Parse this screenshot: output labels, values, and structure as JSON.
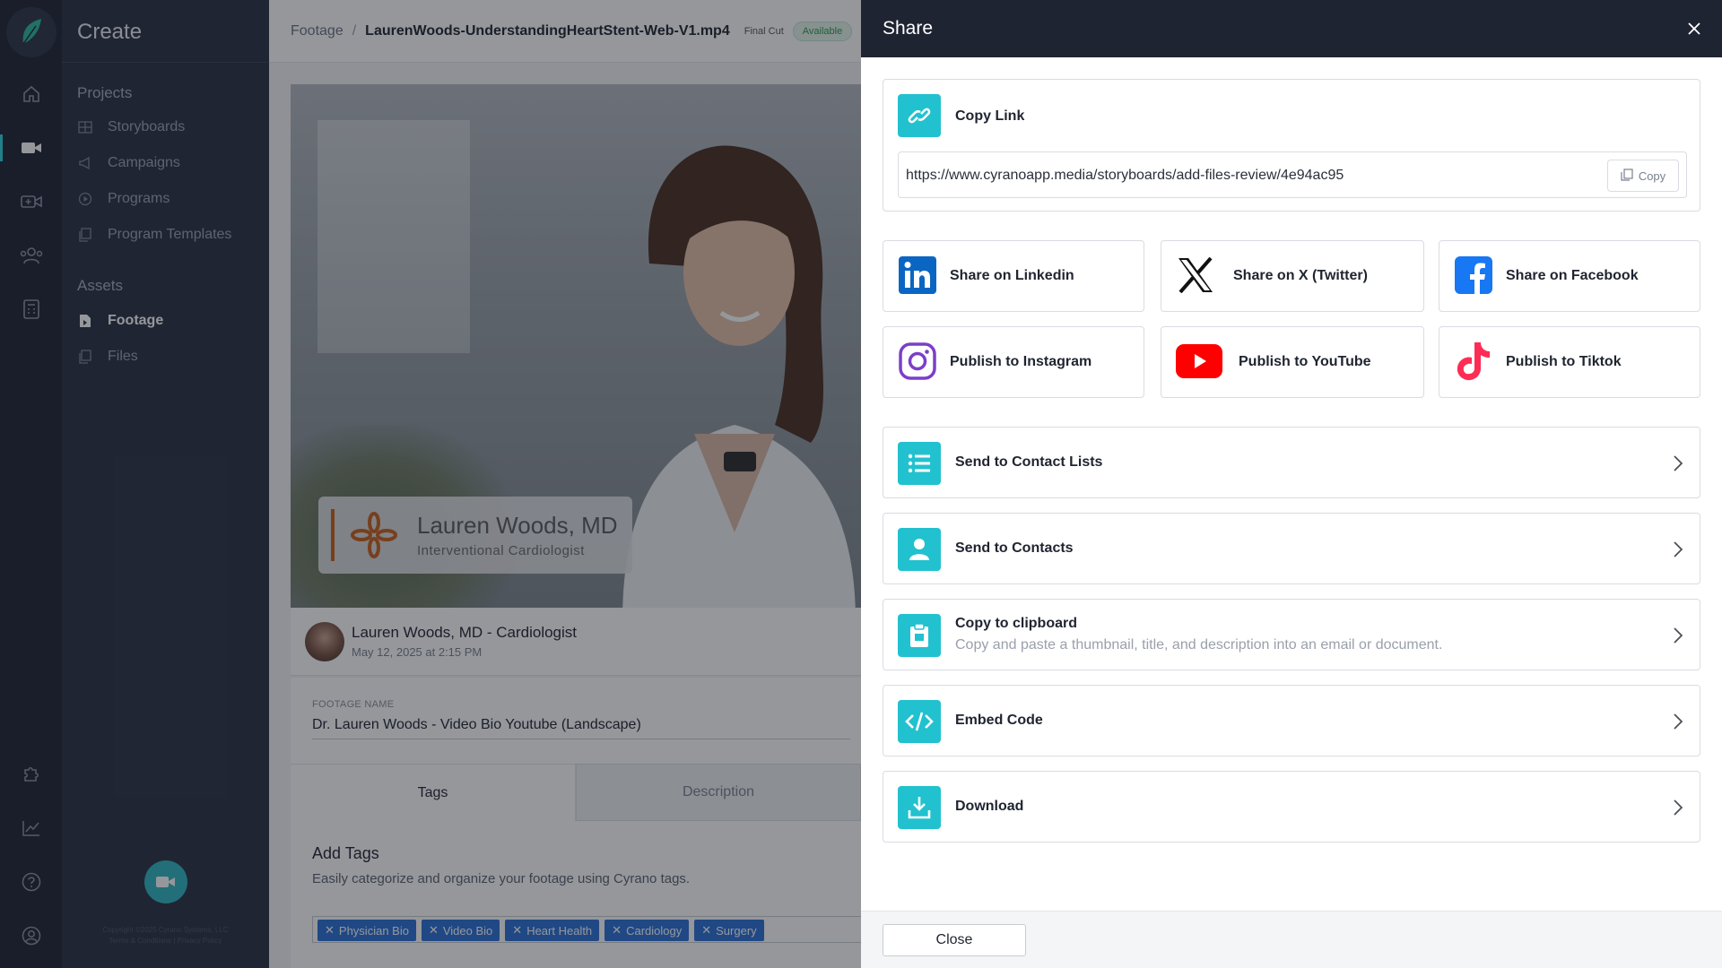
{
  "app": {
    "title": "Create",
    "copyright_line1": "Copyright ©2025 Cyrano Systems, LLC",
    "copyright_line2": "Terms & Conditions | Privacy Policy"
  },
  "rail": {
    "icons": [
      "leaf-logo-icon",
      "home-icon",
      "video-camera-icon",
      "video-add-icon",
      "users-icon",
      "calculator-icon",
      "puzzle-icon",
      "chart-icon",
      "help-icon",
      "user-circle-icon"
    ]
  },
  "nav": {
    "projects_label": "Projects",
    "projects": [
      {
        "label": "Storyboards",
        "icon": "grid-icon"
      },
      {
        "label": "Campaigns",
        "icon": "megaphone-icon"
      },
      {
        "label": "Programs",
        "icon": "play-circle-icon"
      },
      {
        "label": "Program Templates",
        "icon": "copy-icon"
      }
    ],
    "assets_label": "Assets",
    "assets": [
      {
        "label": "Footage",
        "icon": "film-icon",
        "active": true
      },
      {
        "label": "Files",
        "icon": "files-icon"
      }
    ]
  },
  "main": {
    "breadcrumb_root": "Footage",
    "breadcrumb_sep": "/",
    "file_name": "LaurenWoods-UnderstandingHeartStent-Web-V1.mp4",
    "stage_tag": "Final Cut",
    "status_badge": "Available",
    "lower_third_name": "Lauren Woods, MD",
    "lower_third_role": "Interventional Cardiologist",
    "uploader": "Lauren Woods,  MD - Cardiologist",
    "uploaded_at": "May 12, 2025 at 2:15 PM",
    "footage_name_label": "FOOTAGE NAME",
    "footage_name_value": "Dr. Lauren Woods  - Video Bio Youtube (Landscape)",
    "tabs": [
      "Tags",
      "Description"
    ],
    "tags_heading": "Add Tags",
    "tags_help": "Easily categorize and organize your footage using Cyrano tags.",
    "tags": [
      "Physician Bio",
      "Video Bio",
      "Heart Health",
      "Cardiology",
      "Surgery"
    ]
  },
  "share": {
    "title": "Share",
    "copy_link_label": "Copy Link",
    "url": "https://www.cyranoapp.media/storyboards/add-files-review/4e94ac95",
    "copy_button": "Copy",
    "social": [
      {
        "label": "Share on Linkedin",
        "icon": "linkedin-icon"
      },
      {
        "label": "Share on X (Twitter)",
        "icon": "x-twitter-icon"
      },
      {
        "label": "Share on Facebook",
        "icon": "facebook-icon"
      },
      {
        "label": "Publish to Instagram",
        "icon": "instagram-icon"
      },
      {
        "label": "Publish to YouTube",
        "icon": "youtube-icon"
      },
      {
        "label": "Publish to Tiktok",
        "icon": "tiktok-icon"
      }
    ],
    "rows": [
      {
        "label": "Send to Contact Lists",
        "icon": "list-icon"
      },
      {
        "label": "Send to Contacts",
        "icon": "person-icon"
      },
      {
        "label": "Copy to clipboard",
        "desc": "Copy and paste a thumbnail, title, and description into an email or document.",
        "icon": "clipboard-icon"
      },
      {
        "label": "Embed Code",
        "icon": "code-icon"
      },
      {
        "label": "Download",
        "icon": "download-icon"
      }
    ],
    "close_button": "Close"
  },
  "colors": {
    "accent": "#22c1cf",
    "rail_bg": "#1f2433",
    "nav_bg": "#2a3142",
    "tag_chip": "#2a6fd6"
  }
}
